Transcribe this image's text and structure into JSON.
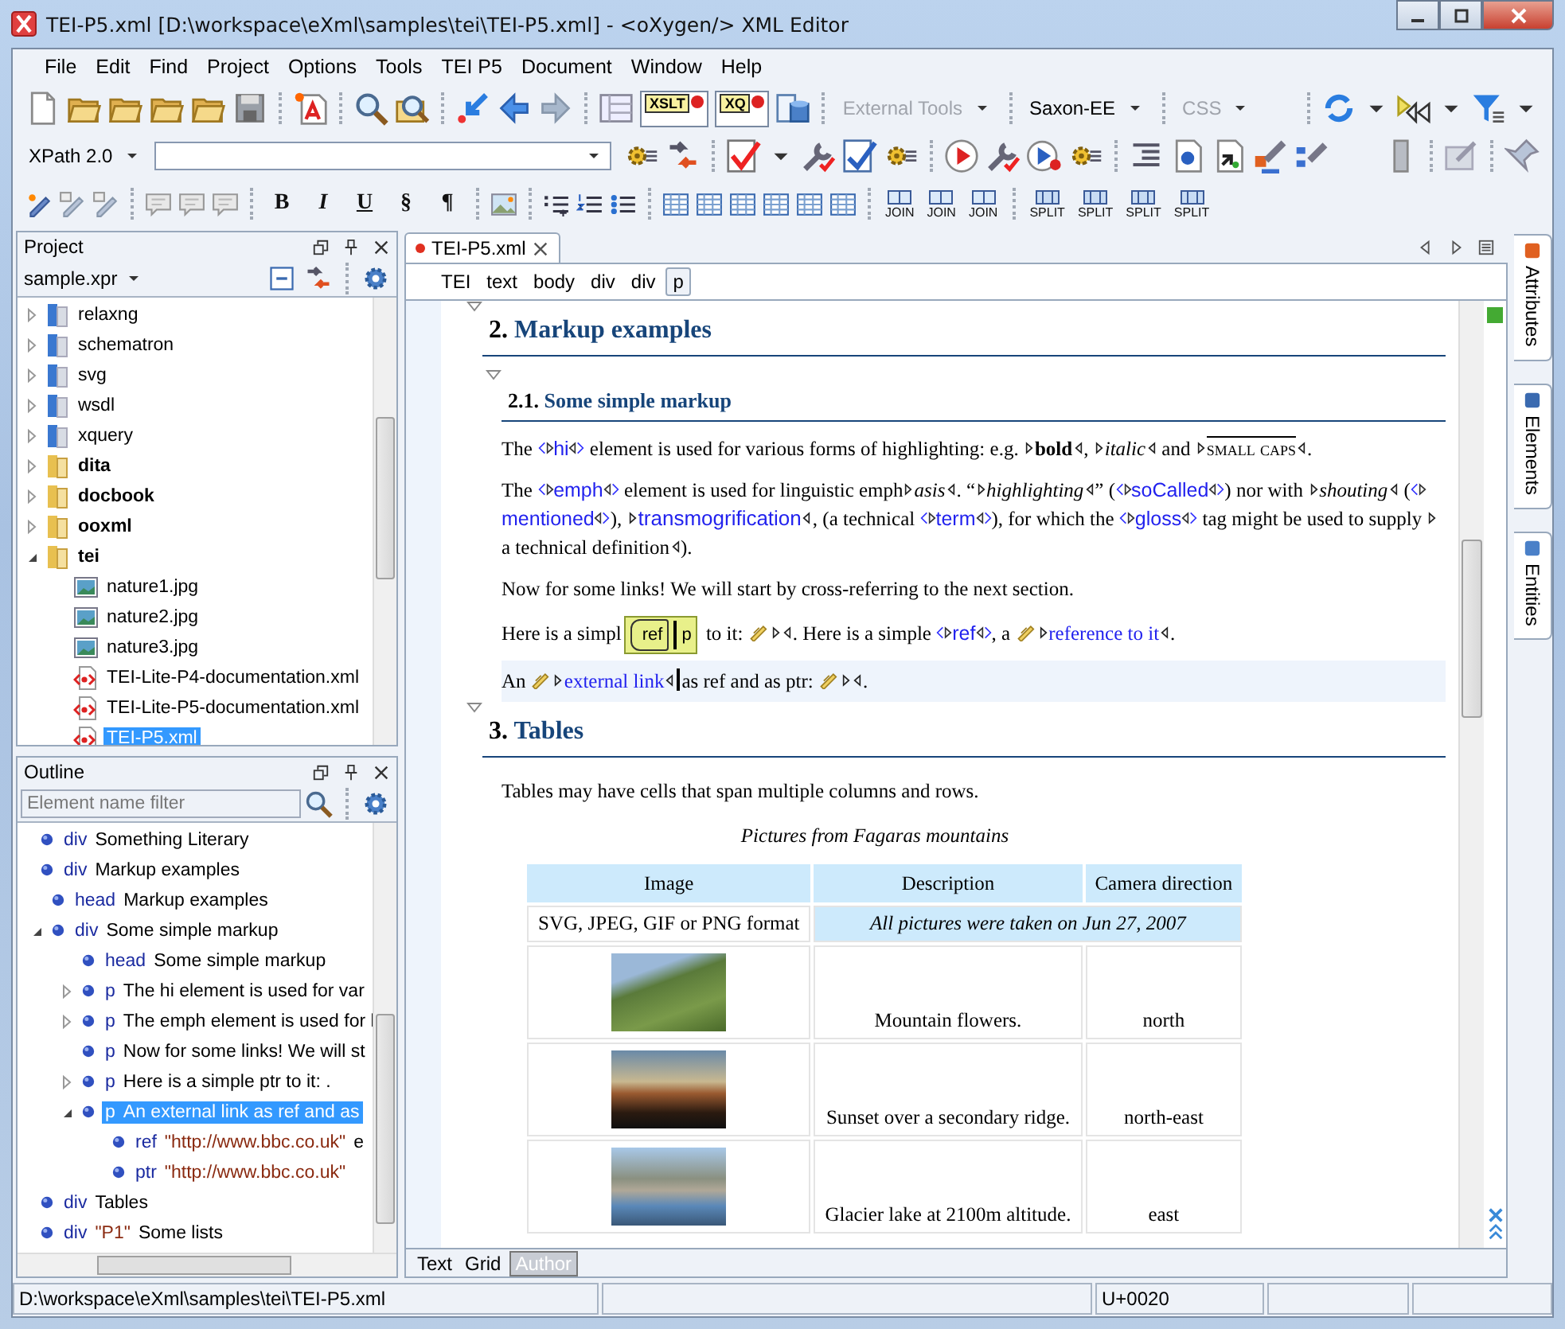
{
  "window": {
    "title": "TEI-P5.xml [D:\\workspace\\eXml\\samples\\tei\\TEI-P5.xml] - <oXygen/> XML Editor"
  },
  "menu": [
    "File",
    "Edit",
    "Find",
    "Project",
    "Options",
    "Tools",
    "TEI P5",
    "Document",
    "Window",
    "Help"
  ],
  "toolbar": {
    "debug_labels": [
      "XSLT",
      "XQ"
    ],
    "combos": [
      {
        "label": "External Tools",
        "disabled": true
      },
      {
        "label": "Saxon-EE",
        "disabled": false
      },
      {
        "label": "CSS",
        "disabled": true
      }
    ],
    "xpath_version": "XPath 2.0",
    "format_buttons": [
      "B",
      "I",
      "U",
      "§",
      "¶"
    ],
    "join_buttons": [
      "JOIN",
      "JOIN",
      "JOIN"
    ],
    "split_buttons": [
      "SPLIT",
      "SPLIT",
      "SPLIT",
      "SPLIT"
    ]
  },
  "project": {
    "title": "Project",
    "project_file": "sample.xpr",
    "items": [
      {
        "kind": "linked-folder",
        "label": "relaxng",
        "expanded": false,
        "selected": false
      },
      {
        "kind": "linked-folder",
        "label": "schematron",
        "expanded": false,
        "selected": false
      },
      {
        "kind": "linked-folder",
        "label": "svg",
        "expanded": false,
        "selected": false
      },
      {
        "kind": "linked-folder",
        "label": "wsdl",
        "expanded": false,
        "selected": false
      },
      {
        "kind": "linked-folder",
        "label": "xquery",
        "expanded": false,
        "selected": false
      },
      {
        "kind": "folder",
        "label": "dita",
        "expanded": false,
        "selected": false
      },
      {
        "kind": "folder",
        "label": "docbook",
        "expanded": false,
        "selected": false
      },
      {
        "kind": "folder",
        "label": "ooxml",
        "expanded": false,
        "selected": false
      },
      {
        "kind": "folder",
        "label": "tei",
        "expanded": true,
        "selected": false,
        "children": [
          {
            "kind": "image",
            "label": "nature1.jpg",
            "selected": false
          },
          {
            "kind": "image",
            "label": "nature2.jpg",
            "selected": false
          },
          {
            "kind": "image",
            "label": "nature3.jpg",
            "selected": false
          },
          {
            "kind": "xml",
            "label": "TEI-Lite-P4-documentation.xml",
            "selected": false
          },
          {
            "kind": "xml",
            "label": "TEI-Lite-P5-documentation.xml",
            "selected": false
          },
          {
            "kind": "xml",
            "label": "TEI-P5.xml",
            "selected": true
          }
        ]
      }
    ]
  },
  "outline": {
    "title": "Outline",
    "filter": {
      "placeholder": "Element name filter"
    },
    "items": [
      {
        "tag": "div",
        "label": "Something Literary",
        "selected": false
      },
      {
        "tag": "div",
        "label": "Markup examples",
        "selected": false,
        "children": [
          {
            "tag": "head",
            "label": "Markup examples",
            "selected": false
          },
          {
            "tag": "div",
            "label": "Some simple markup",
            "expanded": true,
            "selected": false,
            "children": [
              {
                "tag": "head",
                "label": "Some simple markup",
                "selected": false
              },
              {
                "tag": "p",
                "label": "The hi element is used for var",
                "expanded": false,
                "selected": false
              },
              {
                "tag": "p",
                "label": "The emph element is used for l",
                "expanded": false,
                "selected": false
              },
              {
                "tag": "p",
                "label": "Now for some links! We will st",
                "selected": false
              },
              {
                "tag": "p",
                "label": "Here is a simple ptr to it: .",
                "expanded": false,
                "selected": false
              },
              {
                "tag": "p",
                "label": "An external link as ref and as",
                "expanded": true,
                "selected": true,
                "children": [
                  {
                    "tag": "ref",
                    "attribute": "\"http://www.bbc.co.uk\"",
                    "label": "e",
                    "selected": false
                  },
                  {
                    "tag": "ptr",
                    "attribute": "\"http://www.bbc.co.uk\"",
                    "selected": false
                  }
                ]
              }
            ]
          }
        ]
      },
      {
        "tag": "div",
        "label": "Tables",
        "selected": false
      },
      {
        "tag": "div",
        "attribute": "\"P1\"",
        "label": "Some lists",
        "selected": false
      }
    ]
  },
  "editor": {
    "tab": {
      "label": "TEI-P5.xml",
      "modified": true
    },
    "breadcrumb": [
      {
        "label": "TEI",
        "selected": false
      },
      {
        "label": "text",
        "selected": false
      },
      {
        "label": "body",
        "selected": false
      },
      {
        "label": "div",
        "selected": false
      },
      {
        "label": "div",
        "selected": false
      },
      {
        "label": "p",
        "selected": true
      }
    ],
    "blocks": [
      {
        "kind": "heading",
        "number": "2.",
        "title": "Markup examples"
      },
      {
        "kind": "subheading",
        "number": "2.1.",
        "title": "Some simple markup"
      },
      {
        "kind": "paragraph",
        "current": false,
        "segments": [
          {
            "kind": "text",
            "text": "The "
          },
          {
            "kind": "tag",
            "text": "hi"
          },
          {
            "kind": "text",
            "text": " element is used for various forms of highlighting: e.g. "
          },
          {
            "kind": "bold",
            "text": "bold"
          },
          {
            "kind": "text",
            "text": ", "
          },
          {
            "kind": "italic",
            "text": "italic"
          },
          {
            "kind": "text",
            "text": " and "
          },
          {
            "kind": "smallcaps",
            "text": "small caps"
          },
          {
            "kind": "text",
            "text": "."
          }
        ]
      },
      {
        "kind": "paragraph",
        "current": false,
        "segments": [
          {
            "kind": "text",
            "text": "The "
          },
          {
            "kind": "tag",
            "text": "emph"
          },
          {
            "kind": "text",
            "text": " element is used for linguistic emph"
          },
          {
            "kind": "italic",
            "text": "asis"
          },
          {
            "kind": "text",
            "text": ". “"
          },
          {
            "kind": "italic",
            "text": "highlighting"
          },
          {
            "kind": "text",
            "text": "” ("
          },
          {
            "kind": "tag",
            "text": "soCalled"
          },
          {
            "kind": "text",
            "text": ") nor with "
          },
          {
            "kind": "italic",
            "text": "shouting"
          },
          {
            "kind": "text",
            "text": " ("
          },
          {
            "kind": "tag",
            "text": "mentioned"
          },
          {
            "kind": "text",
            "text": "), "
          },
          {
            "kind": "link",
            "text": "transmogrification"
          },
          {
            "kind": "text",
            "text": ", (a technical "
          },
          {
            "kind": "tag",
            "text": "term"
          },
          {
            "kind": "text",
            "text": "), for which the "
          },
          {
            "kind": "tag",
            "text": "gloss"
          },
          {
            "kind": "text",
            "text": " tag might be used to supply "
          },
          {
            "kind": "plain",
            "text": "a technical definition"
          },
          {
            "kind": "text",
            "text": ")."
          }
        ]
      },
      {
        "kind": "paragraph",
        "current": false,
        "segments": [
          {
            "kind": "text",
            "text": "Now for some links! We will start by cross-referring to the next section."
          }
        ]
      },
      {
        "kind": "paragraph",
        "current": false,
        "segments": [
          {
            "kind": "text",
            "text": "Here is a simpl"
          },
          {
            "kind": "tooltip",
            "items": [
              "ref",
              "p"
            ]
          },
          {
            "kind": "text",
            "text": " to it: "
          },
          {
            "kind": "pointer"
          },
          {
            "kind": "text",
            "text": ". Here is a simple "
          },
          {
            "kind": "tag",
            "text": "ref"
          },
          {
            "kind": "text",
            "text": ", a "
          },
          {
            "kind": "pointer",
            "text": "reference to it"
          },
          {
            "kind": "text",
            "text": "."
          }
        ]
      },
      {
        "kind": "paragraph",
        "current": true,
        "segments": [
          {
            "kind": "text",
            "text": "An "
          },
          {
            "kind": "pointer",
            "text": "external link"
          },
          {
            "kind": "caret"
          },
          {
            "kind": "text",
            "text": "as ref and as ptr: "
          },
          {
            "kind": "pointer"
          },
          {
            "kind": "text",
            "text": "."
          }
        ]
      },
      {
        "kind": "heading",
        "number": "3.",
        "title": "Tables"
      },
      {
        "kind": "paragraph",
        "current": false,
        "segments": [
          {
            "kind": "text",
            "text": "Tables may have cells that span multiple columns and rows."
          }
        ]
      },
      {
        "kind": "table",
        "caption": "Pictures from Fagaras mountains",
        "columns": [
          "Image",
          "Description",
          "Camera direction"
        ],
        "rows": [
          {
            "kind": "note",
            "format": "SVG, JPEG, GIF or PNG format",
            "note": "All pictures were taken on Jun 27, 2007"
          },
          {
            "kind": "photo",
            "description": "Mountain flowers.",
            "direction": "north"
          },
          {
            "kind": "photo",
            "description": "Sunset over a secondary ridge.",
            "direction": "north-east"
          },
          {
            "kind": "photo",
            "description": "Glacier lake at 2100m altitude.",
            "direction": "east"
          }
        ]
      }
    ],
    "view_tabs": [
      {
        "label": "Text",
        "selected": false
      },
      {
        "label": "Grid",
        "selected": false
      },
      {
        "label": "Author",
        "selected": true
      }
    ]
  },
  "side_tabs": [
    "Attributes",
    "Elements",
    "Entities"
  ],
  "status_bar": {
    "path": "D:\\workspace\\eXml\\samples\\tei\\TEI-P5.xml",
    "char": "U+0020"
  }
}
